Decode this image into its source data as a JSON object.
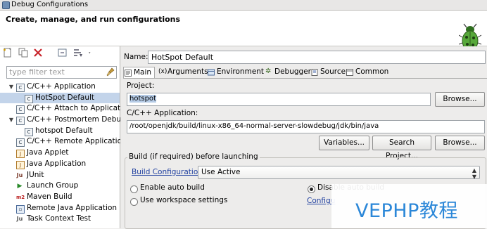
{
  "window": {
    "title": "Debug Configurations"
  },
  "header": {
    "text": "Create, manage, and run configurations"
  },
  "filter": {
    "placeholder": "type filter text"
  },
  "tree": {
    "items": [
      {
        "label": "C/C++ Application",
        "level": 0,
        "expanded": true,
        "icon": "c-app-icon"
      },
      {
        "label": "HotSpot Default",
        "level": 1,
        "selected": true,
        "icon": "c-config-icon"
      },
      {
        "label": "C/C++ Attach to Application",
        "level": 0,
        "icon": "c-attach-icon"
      },
      {
        "label": "C/C++ Postmortem Debugger",
        "level": 0,
        "expanded": true,
        "icon": "c-postmortem-icon"
      },
      {
        "label": "hotspot Default",
        "level": 1,
        "icon": "c-config-icon"
      },
      {
        "label": "C/C++ Remote Application",
        "level": 0,
        "icon": "c-remote-icon"
      },
      {
        "label": "Java Applet",
        "level": 0,
        "icon": "java-applet-icon"
      },
      {
        "label": "Java Application",
        "level": 0,
        "icon": "java-app-icon"
      },
      {
        "label": "JUnit",
        "level": 0,
        "icon": "junit-icon"
      },
      {
        "label": "Launch Group",
        "level": 0,
        "icon": "launch-group-icon"
      },
      {
        "label": "Maven Build",
        "level": 0,
        "icon": "maven-icon"
      },
      {
        "label": "Remote Java Application",
        "level": 0,
        "icon": "remote-java-icon"
      },
      {
        "label": "Task Context Test",
        "level": 0,
        "icon": "task-context-icon"
      }
    ]
  },
  "config": {
    "name_label": "Name:",
    "name_value": "HotSpot Default",
    "tabs": [
      {
        "label": "Main",
        "active": true
      },
      {
        "label": "Arguments"
      },
      {
        "label": "Environment"
      },
      {
        "label": "Debugger"
      },
      {
        "label": "Source"
      },
      {
        "label": "Common"
      }
    ],
    "project_label": "Project:",
    "project_value": "hotspot",
    "browse_label": "Browse...",
    "app_label": "C/C++ Application:",
    "app_value": "/root/openjdk/build/linux-x86_64-normal-server-slowdebug/jdk/bin/java",
    "variables_label": "Variables...",
    "search_project_label": "Search Project...",
    "browse2_label": "Browse...",
    "build_group_label": "Build (if required) before launching",
    "build_config_label": "Build Configuration:",
    "build_config_value": "Use Active",
    "enable_auto_build": "Enable auto build",
    "disable_auto_build": "Disable auto build",
    "use_workspace": "Use workspace settings",
    "configure_link": "Configu"
  },
  "watermark": {
    "text": "VEPHP教程"
  }
}
